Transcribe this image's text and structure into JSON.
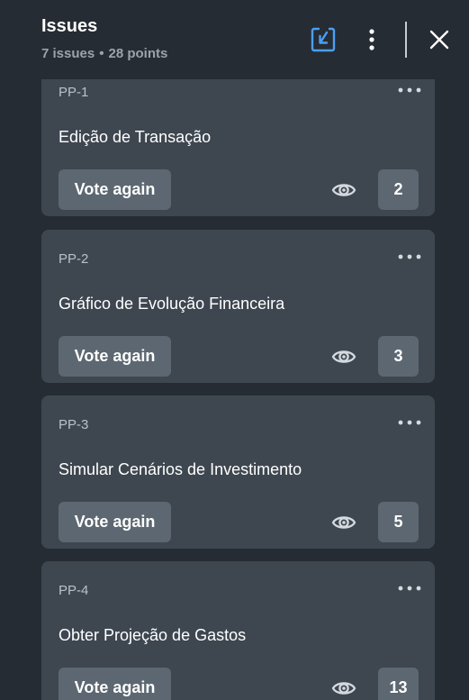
{
  "header": {
    "title": "Issues",
    "issue_count": "7 issues",
    "separator": "•",
    "points_total": "28 points"
  },
  "colors": {
    "background": "#262c33",
    "card": "#3e4750",
    "button": "#5c6771",
    "accent": "#4a9ff5",
    "muted_text": "#9aa3ad"
  },
  "issues": [
    {
      "key": "PP-1",
      "title": "Edição de Transação",
      "vote_label": "Vote again",
      "points": "2"
    },
    {
      "key": "PP-2",
      "title": "Gráfico de Evolução Financeira",
      "vote_label": "Vote again",
      "points": "3"
    },
    {
      "key": "PP-3",
      "title": "Simular Cenários de Investimento",
      "vote_label": "Vote again",
      "points": "5"
    },
    {
      "key": "PP-4",
      "title": "Obter Projeção de Gastos",
      "vote_label": "Vote again",
      "points": "13"
    }
  ]
}
